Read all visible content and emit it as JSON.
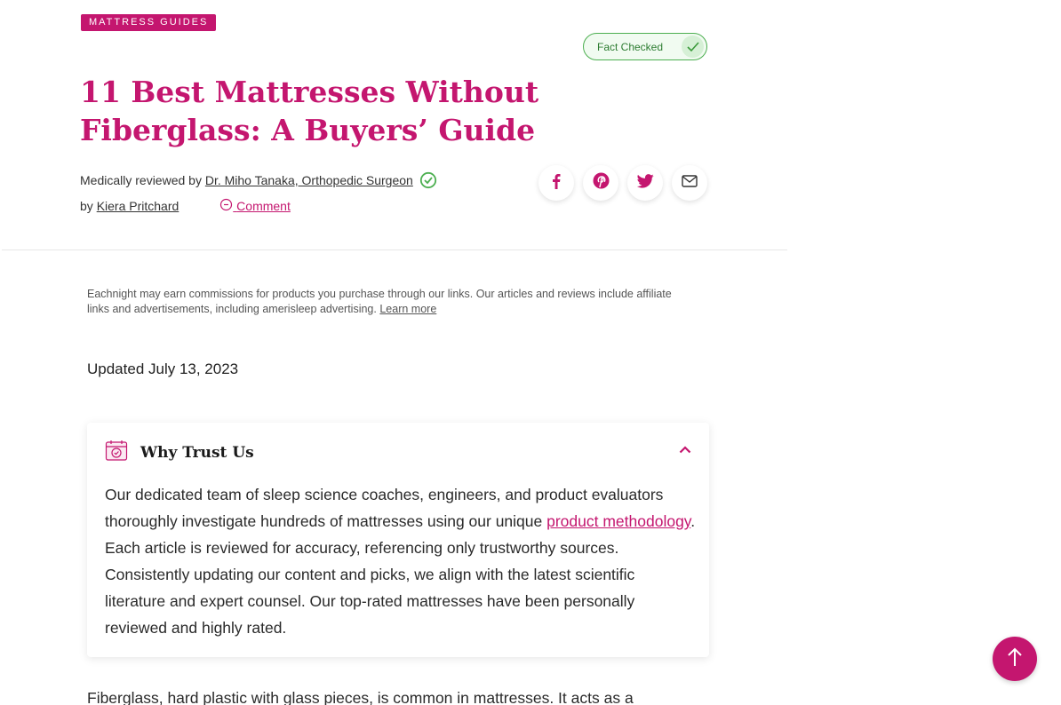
{
  "category": "MATTRESS GUIDES",
  "fact_checked": "Fact Checked",
  "title": "11 Best Mattresses Without Fiberglass: A Buyers’ Guide",
  "reviewed_prefix": "Medically reviewed by",
  "reviewer": "Dr. Miho Tanaka, Orthopedic Surgeon",
  "by_prefix": "by",
  "author": "Kiera Pritchard",
  "comment_label": "Comment",
  "share_icons": [
    "facebook-icon",
    "pinterest-icon",
    "twitter-icon",
    "email-icon"
  ],
  "disclosure": {
    "text": "Eachnight may earn commissions for products you purchase through our links. Our articles and reviews include affiliate links and advertisements, including amerisleep advertising.",
    "link": "Learn more"
  },
  "updated": "Updated July 13, 2023",
  "trust": {
    "title": "Why Trust Us",
    "body_before": "Our dedicated team of sleep science coaches, engineers, and product evaluators thoroughly investigate hundreds of mattresses using our unique ",
    "link": "product methodology",
    "body_after": ". Each article is reviewed for accuracy, referencing only trustworthy sources. Consistently updating our content and picks, we align with the latest scientific literature and expert counsel. Our top-rated mattresses have been personally reviewed and highly rated."
  },
  "intro": "Fiberglass, hard plastic with glass pieces, is common in mattresses. It acts as a",
  "colors": {
    "accent": "#c4166f",
    "verified": "#4caf50"
  }
}
